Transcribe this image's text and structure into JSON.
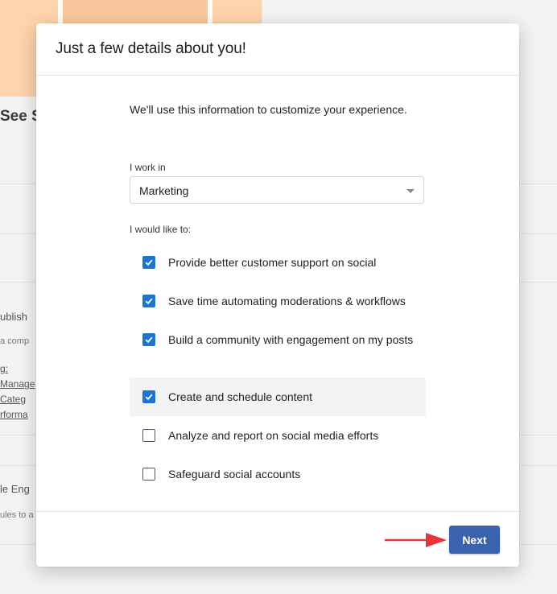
{
  "background": {
    "card_title_fragment": "See S",
    "section1_title_fragment": "ublish",
    "section1_desc_fragment": "a comp",
    "section1_links": [
      "g:",
      "Manage",
      "Categ",
      "rforma"
    ],
    "section2_title_fragment": "le Eng",
    "section2_desc_fragment": "ules to a"
  },
  "modal": {
    "title": "Just a few details about you!",
    "intro": "We'll use this information to customize your experience.",
    "work_label": "I work in",
    "work_value": "Marketing",
    "goals_label": "I would like to:",
    "options": [
      {
        "label": "Provide better customer support on social",
        "checked": true
      },
      {
        "label": "Save time automating moderations & workflows",
        "checked": true
      },
      {
        "label": "Build a community with engagement on my posts",
        "checked": true
      },
      {
        "label": "Create and schedule content",
        "checked": true
      },
      {
        "label": "Analyze and report on social media efforts",
        "checked": false
      },
      {
        "label": "Safeguard social accounts",
        "checked": false
      }
    ],
    "next_label": "Next"
  },
  "colors": {
    "primary_button": "#3a62ad",
    "checkbox_checked": "#1c74d4",
    "annotation_arrow": "#e8333a"
  }
}
